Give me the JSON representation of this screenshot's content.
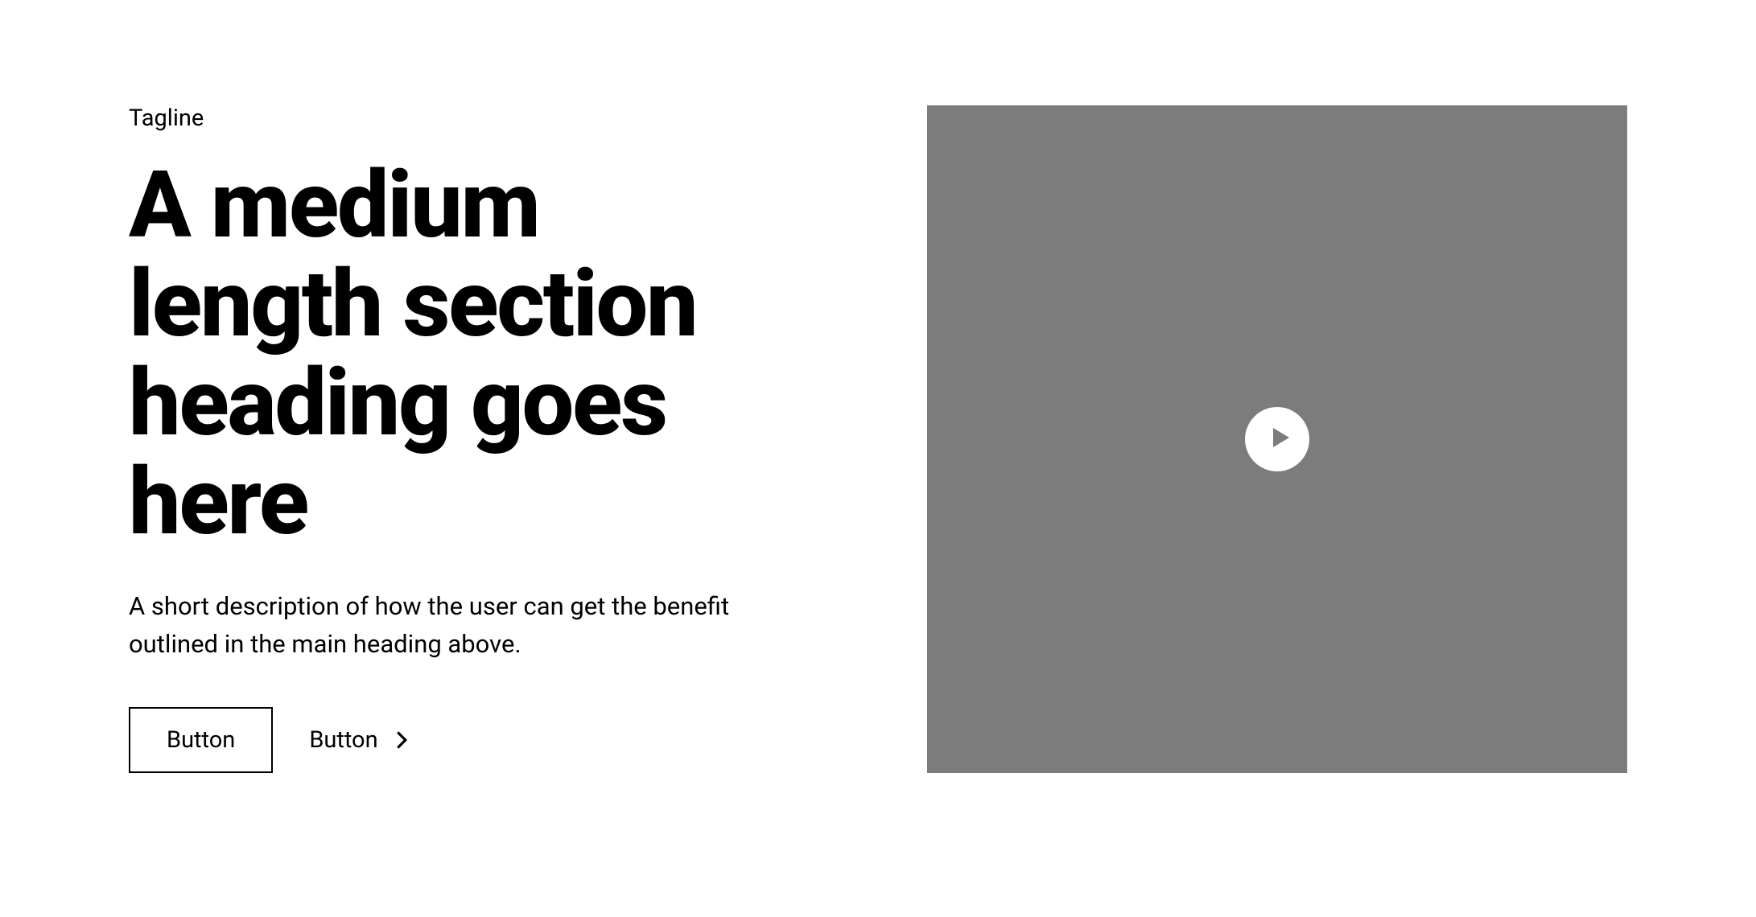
{
  "hero": {
    "tagline": "Tagline",
    "heading": "A medium length section heading goes here",
    "description": "A short description of how the user can get the benefit outlined in the main heading above.",
    "buttons": {
      "primary": "Button",
      "secondary": "Button"
    }
  },
  "colors": {
    "media_bg": "#7c7c7c",
    "text": "#000000",
    "bg": "#ffffff"
  }
}
